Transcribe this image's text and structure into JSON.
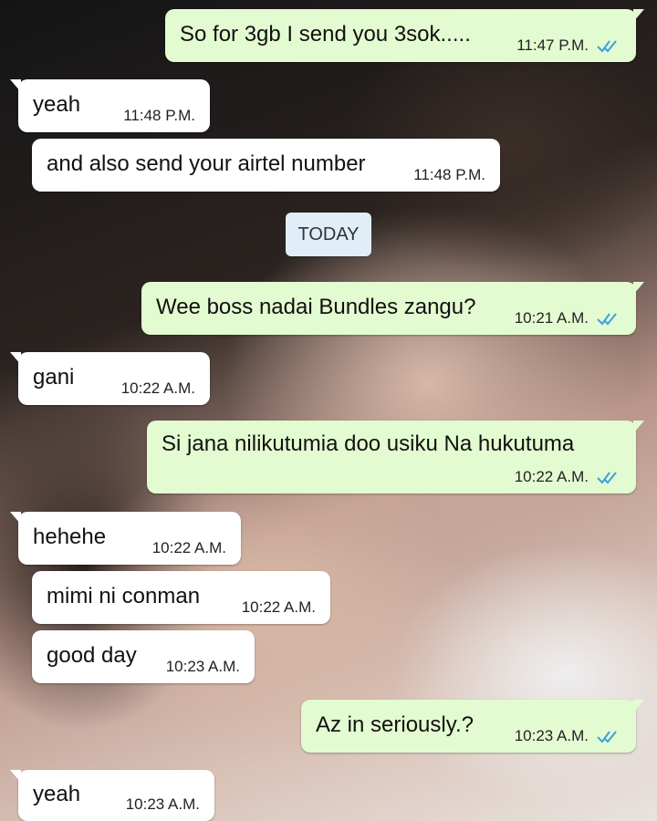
{
  "chat": {
    "day_divider": "TODAY",
    "messages": [
      {
        "text": "So for 3gb I send you 3sok.....",
        "time": "11:47 P.M.",
        "direction": "outgoing",
        "status": "read"
      },
      {
        "text": "yeah",
        "time": "11:48 P.M.",
        "direction": "incoming"
      },
      {
        "text": "and also send your airtel number",
        "time": "11:48 P.M.",
        "direction": "incoming"
      },
      {
        "text": "Wee boss nadai Bundles zangu?",
        "time": "10:21 A.M.",
        "direction": "outgoing",
        "status": "read"
      },
      {
        "text": "gani",
        "time": "10:22 A.M.",
        "direction": "incoming"
      },
      {
        "text": "Si jana nilikutumia doo usiku Na hukutuma",
        "time": "10:22 A.M.",
        "direction": "outgoing",
        "status": "read"
      },
      {
        "text": "hehehe",
        "time": "10:22 A.M.",
        "direction": "incoming"
      },
      {
        "text": "mimi ni conman",
        "time": "10:22 A.M.",
        "direction": "incoming"
      },
      {
        "text": "good day",
        "time": "10:23 A.M.",
        "direction": "incoming"
      },
      {
        "text": "Az in seriously.?",
        "time": "10:23 A.M.",
        "direction": "outgoing",
        "status": "read"
      },
      {
        "text": "yeah",
        "time": "10:23 A.M.",
        "direction": "incoming"
      }
    ]
  },
  "colors": {
    "incoming_bubble": "#ffffff",
    "outgoing_bubble": "#e3fbd0",
    "read_ticks": "#3aa0e0",
    "day_pill": "#dfeef7"
  }
}
